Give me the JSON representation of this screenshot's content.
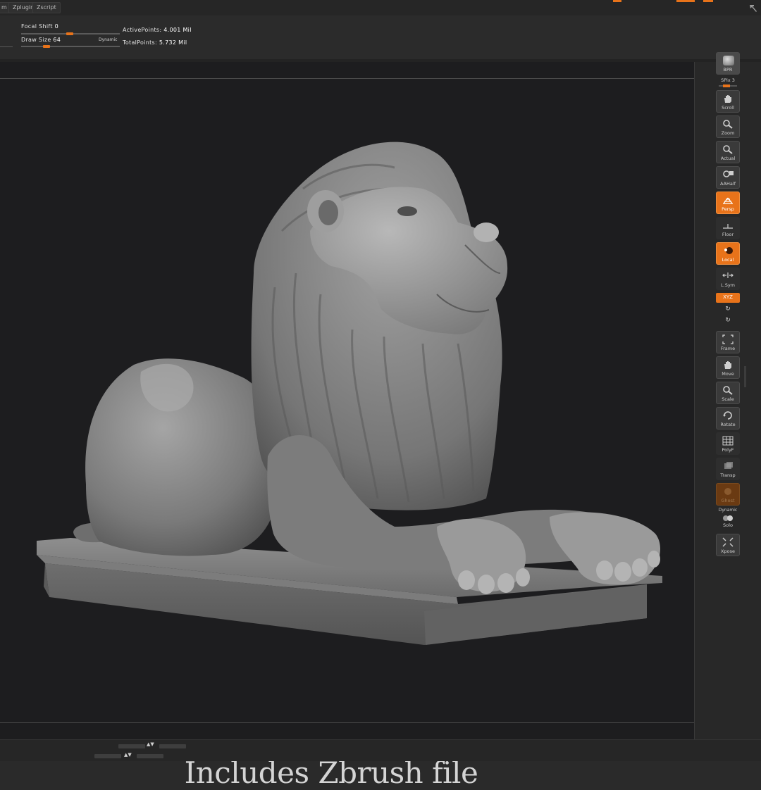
{
  "menubar": {
    "items": [
      "m",
      "Zplugin",
      "Zscript"
    ]
  },
  "shelf": {
    "focal_shift_label": "Focal Shift",
    "focal_shift_value": "0",
    "draw_size_label": "Draw Size",
    "draw_size_value": "64",
    "dynamic_label": "Dynamic",
    "active_points_label": "ActivePoints:",
    "active_points_value": "4.001 Mil",
    "total_points_label": "TotalPoints:",
    "total_points_value": "5.732 Mil"
  },
  "canvas": {
    "caption": "Includes Zbrush file"
  },
  "toolbar": {
    "bpr": "BPR",
    "spix": "SPix 3",
    "scroll": "Scroll",
    "zoom": "Zoom",
    "actual": "Actual",
    "aahalf": "AAHalf",
    "persp": "Persp",
    "floor": "Floor",
    "local": "Local",
    "lsym": "L.Sym",
    "xyz": "XYZ",
    "frame": "Frame",
    "move": "Move",
    "scale": "Scale",
    "rotate": "Rotate",
    "polyf": "PolyF",
    "transp": "Transp",
    "ghost": "Ghost",
    "dynamic": "Dynamic",
    "solo": "Solo",
    "xpose": "Xpose"
  },
  "colors": {
    "accent": "#e8731a",
    "background": "#2a2a2a",
    "canvas": "#1d1d1f",
    "sculpt": "#8a8a8a"
  }
}
